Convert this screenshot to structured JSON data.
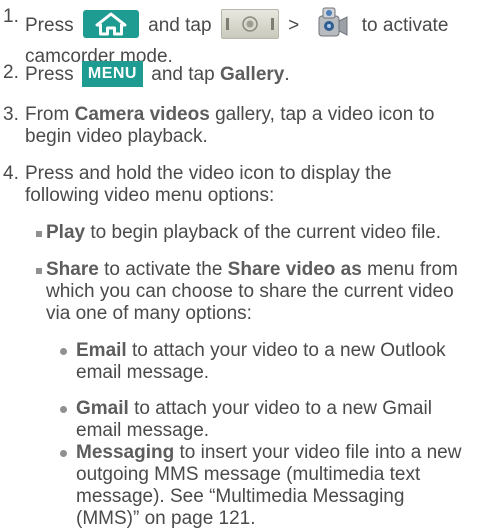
{
  "steps": [
    {
      "number": "1.",
      "parts": {
        "press": "Press",
        "and_tap": "and tap",
        "gt": ">",
        "to_activate": "to activate",
        "line2": "camcorder mode."
      },
      "icons": [
        "home-key-icon",
        "applications-tab-icon",
        "camcorder-icon"
      ]
    },
    {
      "number": "2.",
      "parts": {
        "press": "Press",
        "menu_key": "MENU",
        "and_tap": "and tap",
        "gallery": "Gallery",
        "period": "."
      }
    },
    {
      "number": "3.",
      "parts": {
        "from": "From",
        "gallery_name": "Camera videos",
        "rest_line1": "gallery, tap a video icon to",
        "line2": "begin video playback."
      }
    },
    {
      "number": "4.",
      "parts": {
        "line1": "Press and hold the video icon to display the",
        "line2": "following video menu options:"
      }
    }
  ],
  "options": [
    {
      "label": "Play",
      "text": "to begin playback of the current video file."
    },
    {
      "label": "Share",
      "text_a": "to activate the",
      "menu_name": "Share video as",
      "text_b": "menu from",
      "line2": "which you can choose to share the current video",
      "line3": "via one of many options:"
    }
  ],
  "share_options": [
    {
      "label": "Email",
      "line1": "to attach your video to a new Outlook",
      "line2": "email message."
    },
    {
      "label": "Gmail",
      "line1": "to attach your video to a new Gmail",
      "line2": "email message."
    },
    {
      "label": "Messaging",
      "line1": "to insert your video file into a new",
      "line2": "outgoing MMS message (multimedia text",
      "line3": "message). See “Multimedia Messaging",
      "line4": "(MMS)” on page 121."
    }
  ],
  "colors": {
    "text": "#4a4a4a",
    "accent_teal": "#1f9c92",
    "bullet": "#909090"
  }
}
